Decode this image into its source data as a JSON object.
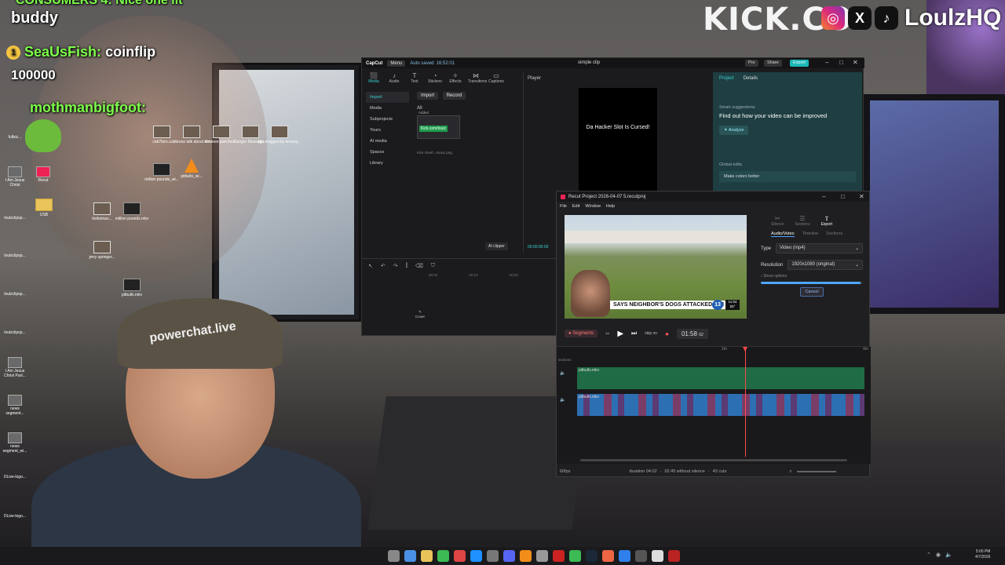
{
  "overlay": {
    "top_chat_partial": "CONSUMERS 4:  Nice one lit",
    "chat_user_top": "buddy",
    "chat_user1": "SeaUsFish:",
    "chat_msg1": "coinflip",
    "chat_points": "100000",
    "chat_user2": "mothmanbigfoot:",
    "brand": "KICK.CO",
    "social_handle": "LoulzHQ",
    "cap_text": "powerchat.live"
  },
  "desktop_icons": [
    {
      "label": "cab7ben..."
    },
    {
      "label": "cobbruns talk about ebz..."
    },
    {
      "label": "kimmee punches..."
    },
    {
      "label": "Danger Message..."
    },
    {
      "label": "clip mogged by snoovy..."
    },
    {
      "label": "million pounds_wi..."
    },
    {
      "label": "pitbulls_wi..."
    },
    {
      "label": "USB"
    },
    {
      "label": "looksmax..."
    },
    {
      "label": "million pounds.mkv"
    },
    {
      "label": "jerry springer..."
    },
    {
      "label": "pitbulls.mkv"
    }
  ],
  "left_icons": [
    {
      "label": "fullsiz..."
    },
    {
      "label": "I Am Jesus Christ"
    },
    {
      "label": "Recut"
    },
    {
      "label": "loulzclipsp..."
    },
    {
      "label": "loulzclipsp..."
    },
    {
      "label": "loulzclipsp..."
    },
    {
      "label": "loulzclipsp..."
    },
    {
      "label": "I Am Jesus Christ Part..."
    },
    {
      "label": "news segment..."
    },
    {
      "label": "news segment_wi..."
    },
    {
      "label": "DLive-logo..."
    },
    {
      "label": "DLive-logo..."
    }
  ],
  "capcut": {
    "logo": "CapCut",
    "menu": "Menu",
    "autosave": "Auto saved: 16:52:01",
    "title": "simple clip",
    "pro": "Pro",
    "share": "Share",
    "export": "Export",
    "tools": [
      {
        "icon": "⬛",
        "label": "Media"
      },
      {
        "icon": "♪",
        "label": "Audio"
      },
      {
        "icon": "T",
        "label": "Text"
      },
      {
        "icon": "◔",
        "label": "Stickers"
      },
      {
        "icon": "✧",
        "label": "Effects"
      },
      {
        "icon": "⋈",
        "label": "Transitions"
      },
      {
        "icon": "▭",
        "label": "Captions"
      }
    ],
    "side": [
      "Import",
      "Media",
      "Subprojects",
      "Yours",
      "AI media",
      "Spaces",
      "Library"
    ],
    "import_btn": "Import",
    "record_btn": "Record",
    "all_label": "All",
    "added_label": "Added",
    "thumb_tag": "Kick.com/loulz",
    "file_name": "Kick Overl...music.png",
    "ai_clipper": "AI clipper",
    "player_label": "Player",
    "video_caption": "Da Hacker Slot Is Cursed!",
    "time": "00:00:00:00",
    "panel_tabs": [
      "Project",
      "Details"
    ],
    "smart_suggestions": "Smart suggestions",
    "find_text": "Find out how your video can be improved",
    "analyze": "Analyze",
    "global_edits": "Global edits",
    "make_colors": "Make colors better",
    "ruler": [
      "00:00",
      "00:10",
      "00:20"
    ],
    "cover": "Cover"
  },
  "recut": {
    "title": "Recut Project 2026-04-07 5.recutproj",
    "menu": [
      "File",
      "Edit",
      "Window",
      "Help"
    ],
    "lower_third": "SAYS NEIGHBOR'S DOGS ATTACKED HIM",
    "channel": "13",
    "clock": "11:04 55°",
    "segments": "Segments",
    "skip": "skip on",
    "timecode": "01:58",
    "timecode_frames": "52",
    "right_tabs": [
      {
        "icon": "✂",
        "label": "Silence"
      },
      {
        "icon": "☰",
        "label": "Sections"
      },
      {
        "icon": "⇧",
        "label": "Export"
      }
    ],
    "sub_tabs": [
      "Audio/Video",
      "Timeline",
      "Sections"
    ],
    "type_label": "Type",
    "type_value": "Video (mp4)",
    "resolution_label": "Resolution",
    "resolution_value": "1920x1080 (original)",
    "show_options": "Show options",
    "progress": 0.98,
    "cancel": "Cancel",
    "ruler": [
      "2m",
      "4m"
    ],
    "sections_label": "sections",
    "track1": "pitbulls.mkv",
    "track2": "pitbulls.mkv",
    "fps": "60fps",
    "duration": "duration 04:02",
    "without_silence": "02:45 without silence",
    "cuts": "43 cuts"
  },
  "taskbar": {
    "time": "5:00 PM",
    "date": "4/7/2026",
    "icon_colors": [
      "#888",
      "#4a90e2",
      "#e8c45a",
      "#3cba54",
      "#d44",
      "#1e90ff",
      "#777",
      "#5865f2",
      "#f28c1a",
      "#999",
      "#c22",
      "#3cba54",
      "#1b2838",
      "#e64",
      "#2f80ed",
      "#555",
      "#ddd",
      "#b22"
    ]
  }
}
